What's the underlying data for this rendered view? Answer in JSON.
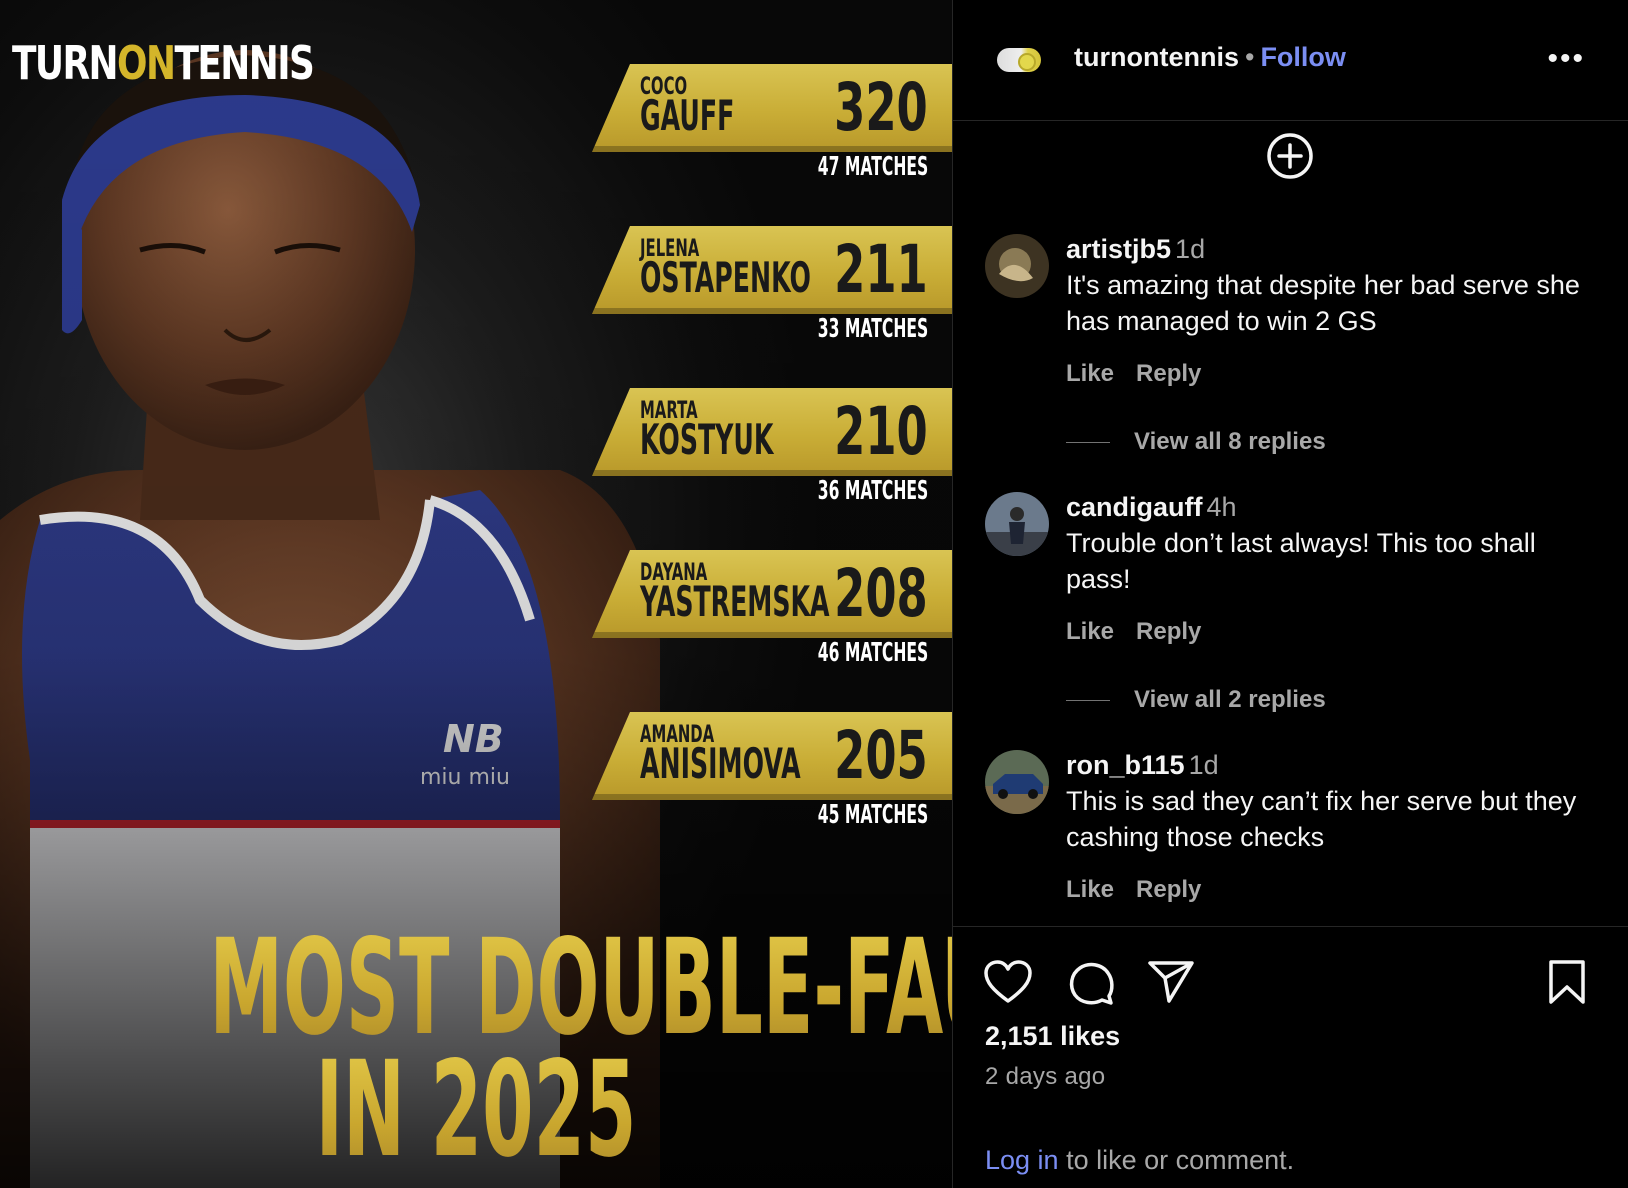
{
  "post": {
    "brand": {
      "pre": "TURN",
      "on": "ON",
      "post": "TENNIS"
    },
    "stats": [
      {
        "first": "COCO",
        "last": "GAUFF",
        "value": "320",
        "matches": "47 MATCHES"
      },
      {
        "first": "JELENA",
        "last": "OSTAPENKO",
        "value": "211",
        "matches": "33 MATCHES"
      },
      {
        "first": "MARTA",
        "last": "KOSTYUK",
        "value": "210",
        "matches": "36 MATCHES"
      },
      {
        "first": "DAYANA",
        "last": "YASTREMSKA",
        "value": "208",
        "matches": "46 MATCHES"
      },
      {
        "first": "AMANDA",
        "last": "ANISIMOVA",
        "value": "205",
        "matches": "45 MATCHES"
      }
    ],
    "headline_line1": "MOST DOUBLE-FAULTS",
    "headline_line2": "IN 2025",
    "shirt_logo": "miu miu"
  },
  "header": {
    "username": "turnontennis",
    "separator": "•",
    "follow_label": "Follow",
    "more_label": "•••"
  },
  "comments": [
    {
      "user": "artistjb5",
      "time": "1d",
      "text": "It's amazing that despite her bad serve she has managed to win 2 GS",
      "like": "Like",
      "reply": "Reply",
      "view_replies": "View all 8 replies"
    },
    {
      "user": "candigauff",
      "time": "4h",
      "text": "Trouble don’t last always! This too shall pass!",
      "like": "Like",
      "reply": "Reply",
      "view_replies": "View all 2 replies"
    },
    {
      "user": "ron_b115",
      "time": "1d",
      "text": "This is sad they can’t fix her serve but they cashing those checks",
      "like": "Like",
      "reply": "Reply"
    }
  ],
  "footer": {
    "likes": "2,151 likes",
    "posted": "2 days ago",
    "login_link": "Log in",
    "login_rest": " to like or comment."
  },
  "colors": {
    "accent_gold": "#d4b52a",
    "link_blue": "#7b8ef3",
    "background": "#000000",
    "muted_text": "#a8a8a8"
  },
  "icons": [
    "plus-circle-icon",
    "heart-icon",
    "comment-icon",
    "share-icon",
    "bookmark-icon",
    "more-icon"
  ]
}
